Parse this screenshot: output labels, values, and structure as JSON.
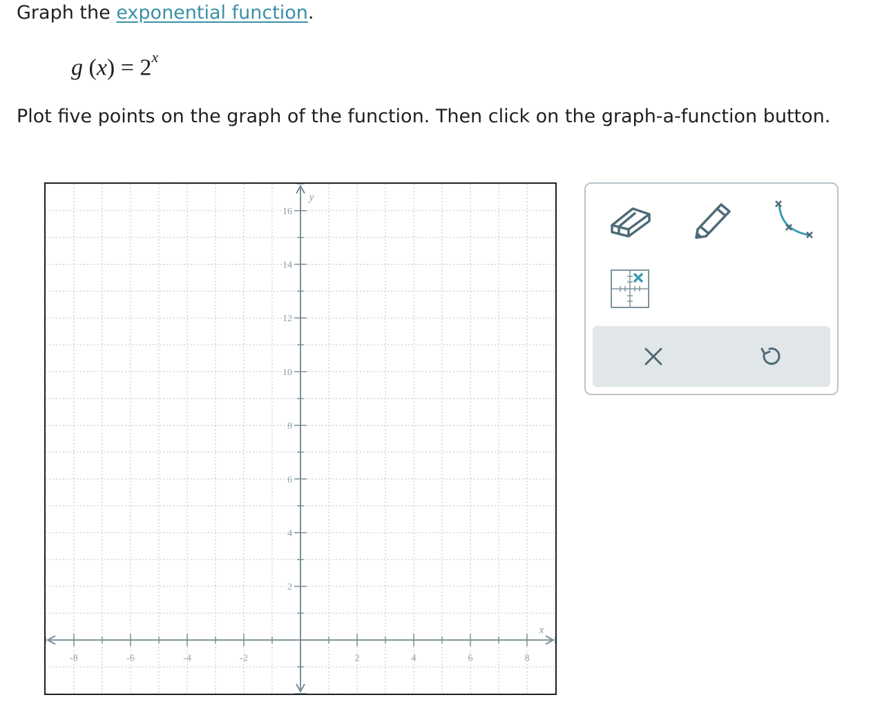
{
  "prompt": {
    "lead": "Graph the ",
    "link": "exponential function",
    "trail": "."
  },
  "formula": {
    "fn": "g",
    "open": "(",
    "var": "x",
    "close": ")",
    "eq": " = 2",
    "exp": "x"
  },
  "instruction": "Plot five points on the graph of the function. Then click on the graph-a-function button.",
  "graph": {
    "x_axis_label": "x",
    "y_axis_label": "y",
    "x_ticks": [
      "-8",
      "-6",
      "-4",
      "-2",
      "2",
      "4",
      "6",
      "8"
    ],
    "y_ticks": [
      "2",
      "4",
      "6",
      "8",
      "10",
      "12",
      "14",
      "16"
    ],
    "x_range": [
      -9,
      9
    ],
    "y_range": [
      -2,
      17
    ],
    "grid": true
  },
  "toolbox": {
    "tools": [
      "eraser-icon",
      "pencil-icon",
      "graph-a-function-icon",
      "point-grid-icon"
    ],
    "actions": [
      "clear-icon",
      "undo-icon"
    ]
  },
  "colors": {
    "link": "#3a8fa6",
    "tool_stroke": "#4e6b77",
    "accent": "#3a9db5",
    "grid": "#b8c3c8",
    "action_bar": "#e1e6e9"
  }
}
